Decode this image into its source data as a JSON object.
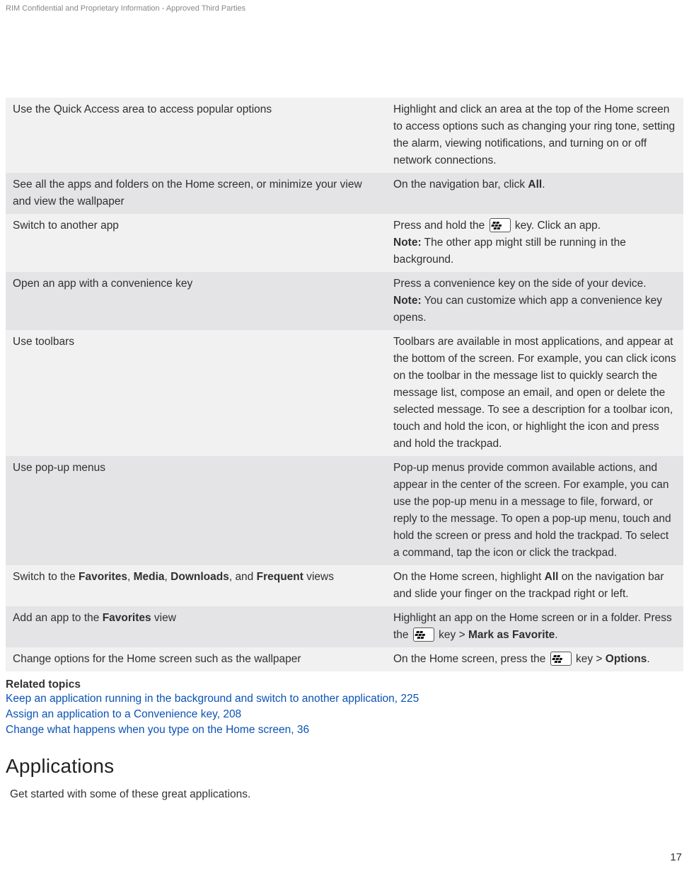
{
  "header": {
    "confidential": "RIM Confidential and Proprietary Information - Approved Third Parties"
  },
  "table": {
    "rows": [
      {
        "left": [
          {
            "text": "Use the Quick Access area to access popular options"
          }
        ],
        "right": [
          {
            "text": "Highlight and click an area at the top of the Home screen to access options such as changing your ring tone, setting the alarm, viewing notifications, and turning on or off network connections."
          }
        ]
      },
      {
        "left": [
          {
            "text": "See all the apps and folders on the Home screen, or minimize your view and view the wallpaper"
          }
        ],
        "right": [
          {
            "text": "On the navigation bar, click "
          },
          {
            "text": "All",
            "bold": true
          },
          {
            "text": "."
          }
        ]
      },
      {
        "left": [
          {
            "text": "Switch to another app"
          }
        ],
        "right": [
          {
            "text": "Press and hold the "
          },
          {
            "icon": "bb-key"
          },
          {
            "text": " key. Click an app."
          },
          {
            "br": true
          },
          {
            "text": "Note:",
            "bold": true
          },
          {
            "text": " The other app might still be running in the background."
          }
        ]
      },
      {
        "left": [
          {
            "text": "Open an app with a convenience key"
          }
        ],
        "right": [
          {
            "text": "Press a convenience key on the side of your device."
          },
          {
            "br": true
          },
          {
            "text": "Note:",
            "bold": true
          },
          {
            "text": " You can customize which app a convenience key opens."
          }
        ]
      },
      {
        "left": [
          {
            "text": "Use toolbars"
          }
        ],
        "right": [
          {
            "text": "Toolbars are available in most applications, and appear at the bottom of the screen. For example, you can click icons on the toolbar in the message list to quickly search the message list, compose an email, and open or delete the selected message. To see a description for a toolbar icon, touch and hold the icon, or highlight the icon and press and hold the trackpad."
          }
        ]
      },
      {
        "left": [
          {
            "text": "Use pop-up menus"
          }
        ],
        "right": [
          {
            "text": "Pop-up menus provide common available actions, and appear in the center of the screen. For example, you can use the pop-up menu in a message to file, forward, or reply to the message. To open a pop-up menu, touch and hold the screen or press and hold the trackpad. To select a command, tap the icon or click the trackpad."
          }
        ]
      },
      {
        "left": [
          {
            "text": "Switch to the "
          },
          {
            "text": "Favorites",
            "bold": true
          },
          {
            "text": ", "
          },
          {
            "text": "Media",
            "bold": true
          },
          {
            "text": ", "
          },
          {
            "text": "Downloads",
            "bold": true
          },
          {
            "text": ", and "
          },
          {
            "text": "Frequent",
            "bold": true
          },
          {
            "text": " views"
          }
        ],
        "right": [
          {
            "text": "On the Home screen, highlight "
          },
          {
            "text": "All",
            "bold": true
          },
          {
            "text": " on the navigation bar and slide your finger on the trackpad right or left."
          }
        ]
      },
      {
        "left": [
          {
            "text": "Add an app to the "
          },
          {
            "text": "Favorites",
            "bold": true
          },
          {
            "text": " view"
          }
        ],
        "right": [
          {
            "text": "Highlight an app on the Home screen or in a folder. Press the "
          },
          {
            "icon": "bb-key"
          },
          {
            "text": " key > "
          },
          {
            "text": "Mark as Favorite",
            "bold": true
          },
          {
            "text": "."
          }
        ]
      },
      {
        "left": [
          {
            "text": "Change options for the Home screen such as the wallpaper"
          }
        ],
        "right": [
          {
            "text": "On the Home screen, press the "
          },
          {
            "icon": "bb-key"
          },
          {
            "text": " key > "
          },
          {
            "text": "Options",
            "bold": true
          },
          {
            "text": "."
          }
        ]
      }
    ]
  },
  "related": {
    "heading": "Related topics",
    "links": [
      "Keep an application running in the background and switch to another application, 225",
      "Assign an application to a Convenience key, 208",
      "Change what happens when you type on the Home screen, 36"
    ]
  },
  "section": {
    "heading": "Applications",
    "text": "Get started with some of these great applications."
  },
  "pagenum": "17"
}
